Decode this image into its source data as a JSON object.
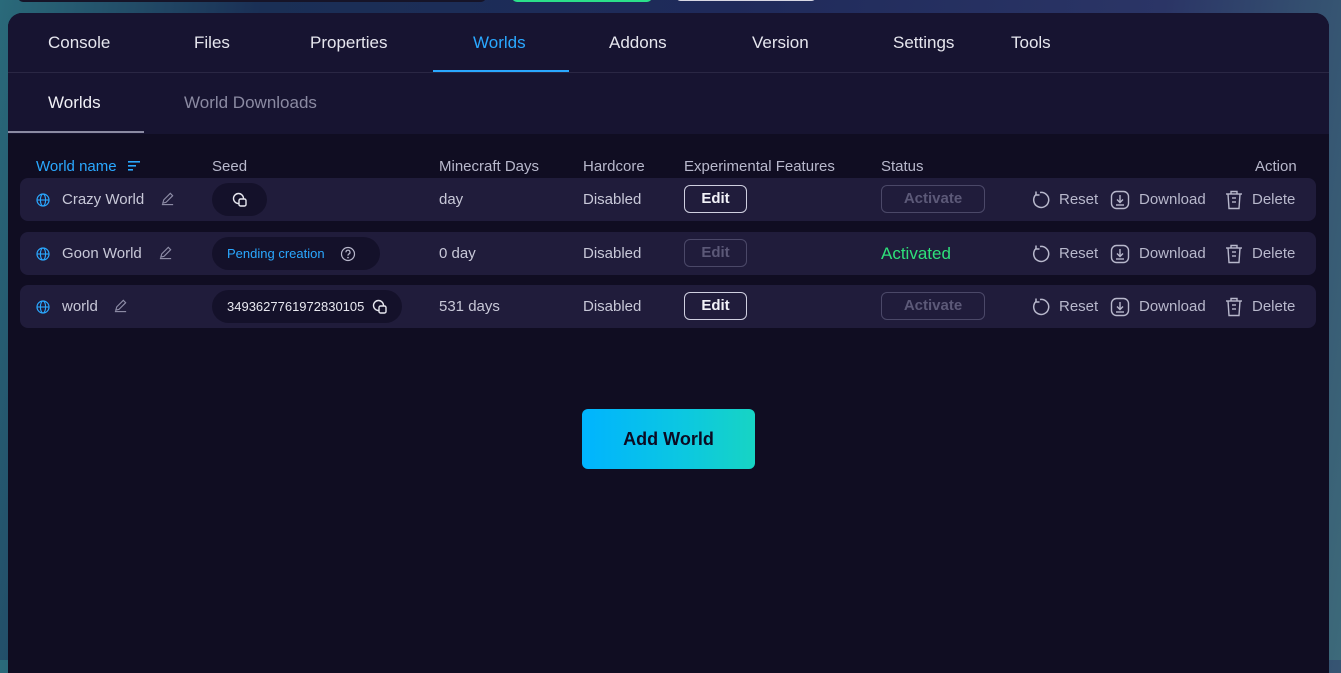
{
  "tabs": [
    "Console",
    "Files",
    "Properties",
    "Worlds",
    "Addons",
    "Version",
    "Settings",
    "Tools"
  ],
  "active_tab": "Worlds",
  "subtabs": [
    "Worlds",
    "World Downloads"
  ],
  "table": {
    "headers": {
      "name": "World name",
      "seed": "Seed",
      "days": "Minecraft Days",
      "hardcore": "Hardcore",
      "experimental": "Experimental Features",
      "status": "Status",
      "action": "Action"
    },
    "rows": [
      {
        "name": "Crazy World",
        "seed": "",
        "days": "day",
        "hardcore": "Disabled",
        "edit_label": "Edit",
        "status_label": "Activate",
        "reset": "Reset",
        "download": "Download",
        "delete": "Delete"
      },
      {
        "name": "Goon World",
        "seed": "Pending creation",
        "days": "0 day",
        "hardcore": "Disabled",
        "edit_label": "Edit",
        "status_label": "Activated",
        "reset": "Reset",
        "download": "Download",
        "delete": "Delete"
      },
      {
        "name": "world",
        "seed": "3493627761972830105",
        "days": "531 days",
        "hardcore": "Disabled",
        "edit_label": "Edit",
        "status_label": "Activate",
        "reset": "Reset",
        "download": "Download",
        "delete": "Delete"
      }
    ]
  },
  "add_world_label": "Add World",
  "colors": {
    "accent": "#2aa8ff",
    "activated": "#2ee07a",
    "panel": "#100d22",
    "row": "#201c3b"
  }
}
